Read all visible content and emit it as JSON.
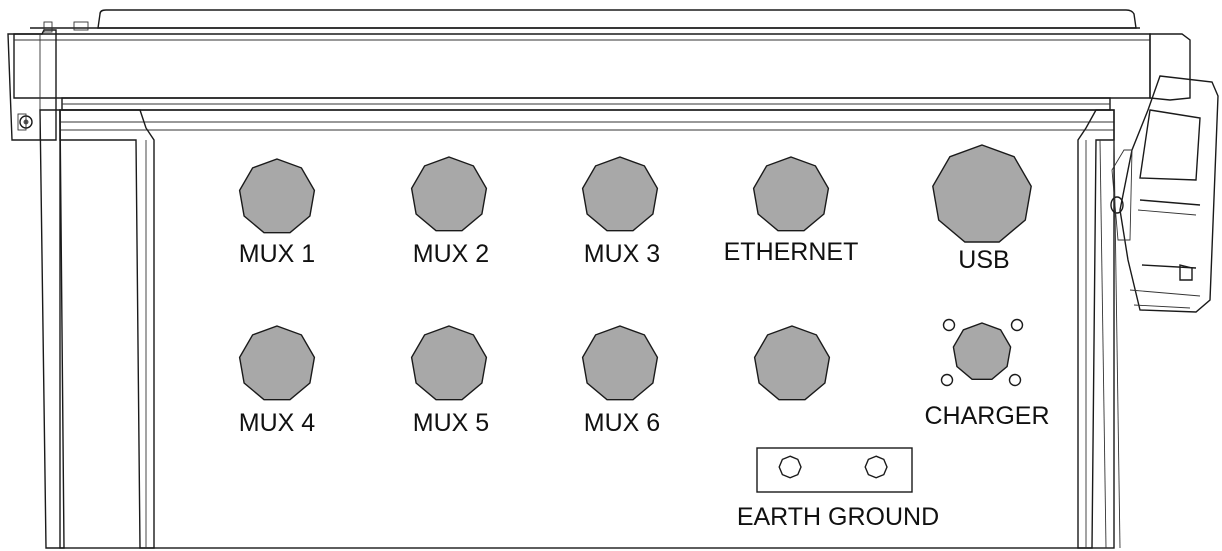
{
  "colors": {
    "enclosure": "#c9c9c9",
    "lid": "#cdcdcd",
    "port": "#a8a8a8",
    "outline": "#1a1a1a",
    "background": "#ffffff"
  },
  "ports": [
    {
      "id": "mux-1",
      "label": "MUX 1",
      "size": "standard"
    },
    {
      "id": "mux-2",
      "label": "MUX 2",
      "size": "standard"
    },
    {
      "id": "mux-3",
      "label": "MUX 3",
      "size": "standard"
    },
    {
      "id": "ethernet",
      "label": "ETHERNET",
      "size": "standard"
    },
    {
      "id": "usb",
      "label": "USB",
      "size": "large"
    },
    {
      "id": "mux-4",
      "label": "MUX 4",
      "size": "standard"
    },
    {
      "id": "mux-5",
      "label": "MUX 5",
      "size": "standard"
    },
    {
      "id": "mux-6",
      "label": "MUX 6",
      "size": "standard"
    },
    {
      "id": "unlabeled",
      "label": "",
      "size": "standard"
    },
    {
      "id": "charger",
      "label": "CHARGER",
      "size": "small",
      "mounting_screws": 4
    }
  ],
  "earth_ground": {
    "label": "EARTH GROUND",
    "terminals": 2
  }
}
